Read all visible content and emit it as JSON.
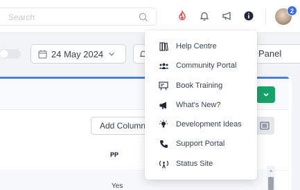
{
  "search": {
    "placeholder": "Search"
  },
  "header": {
    "notification_badge": "2",
    "icons": [
      "flame-icon",
      "bell-icon",
      "megaphone-icon",
      "info-icon"
    ],
    "colors": {
      "flame": "#e5484d",
      "badge": "#3b6fd8"
    }
  },
  "toolbar": {
    "date_label": "24 May 2024",
    "panel_label": "Panel"
  },
  "table": {
    "add_column_label": "Add Column",
    "column_header": "PP",
    "cell_value": "Yes"
  },
  "help_menu": {
    "items": [
      {
        "label": "Help Centre",
        "icon": "book-icon"
      },
      {
        "label": "Community Portal",
        "icon": "community-icon"
      },
      {
        "label": "Book Training",
        "icon": "training-icon"
      },
      {
        "label": "What's New?",
        "icon": "megaphone-icon"
      },
      {
        "label": "Development Ideas",
        "icon": "lightbulb-icon"
      },
      {
        "label": "Support Portal",
        "icon": "phone-icon"
      },
      {
        "label": "Status Site",
        "icon": "broadcast-icon"
      }
    ]
  },
  "colors": {
    "accent": "#4a7fd9",
    "success": "#16a36a"
  }
}
